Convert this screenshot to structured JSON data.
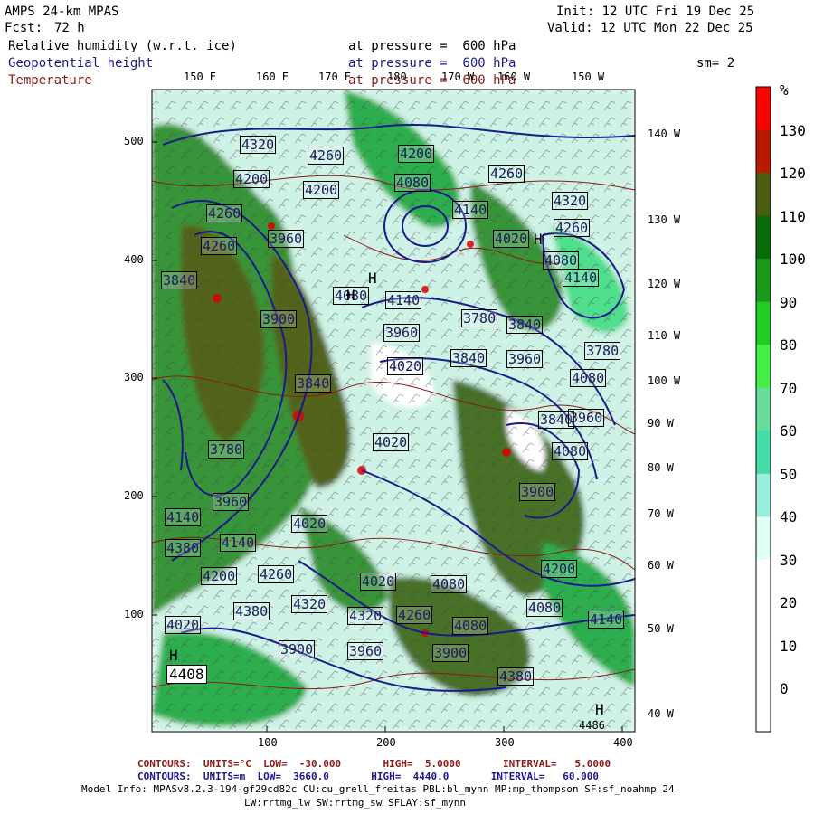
{
  "header": {
    "model": "AMPS 24-km MPAS",
    "fcst_label": "Fcst:",
    "fcst_value": "72 h",
    "init": "Init: 12 UTC Fri 19 Dec 25",
    "valid": "Valid: 12 UTC Mon 22 Dec 25",
    "fields": [
      {
        "name": "Relative humidity (w.r.t. ice)",
        "level": "at pressure =  600 hPa"
      },
      {
        "name": "Geopotential height",
        "level": "at pressure =  600 hPa"
      },
      {
        "name": "Temperature",
        "level": "at pressure =  600 hPa"
      }
    ],
    "smoothing": "sm= 2"
  },
  "axes": {
    "x_ticks": [
      "100",
      "200",
      "300",
      "400"
    ],
    "y_ticks": [
      "100",
      "200",
      "300",
      "400",
      "500"
    ],
    "top_lon": [
      "150 E",
      "160 E",
      "170 E",
      "180",
      "170 W",
      "160 W",
      "150 W"
    ],
    "right_lon": [
      "140 W",
      "130 W",
      "120 W",
      "110 W",
      "100 W",
      "90 W",
      "80 W",
      "70 W",
      "60 W",
      "50 W",
      "40 W"
    ]
  },
  "colorbar": {
    "unit": "%",
    "labels": [
      "130",
      "120",
      "110",
      "100",
      "90",
      "80",
      "70",
      "60",
      "50",
      "40",
      "30",
      "20",
      "10",
      "0"
    ],
    "colors": [
      "#ff0000",
      "#b81a00",
      "#4a5c10",
      "#0a6b0a",
      "#1a9a1a",
      "#22cc22",
      "#44ee44",
      "#66dd99",
      "#44ddaa",
      "#99eedd",
      "#ddfff4",
      "#ffffff",
      "#ffffff",
      "#ffffff",
      "#ffffff"
    ]
  },
  "height_labels": [
    "4320",
    "4260",
    "4200",
    "4260",
    "4260",
    "4080",
    "4140",
    "4320",
    "4200",
    "4200",
    "4260",
    "3960",
    "4260",
    "4020",
    "4080",
    "4140",
    "3840",
    "3900",
    "4080",
    "4140",
    "3780",
    "3840",
    "3780",
    "3960",
    "4020",
    "3840",
    "3960",
    "4080",
    "3840",
    "3840",
    "3780",
    "4020",
    "4080",
    "3960",
    "3960",
    "3900",
    "4140",
    "4020",
    "4140",
    "4380",
    "4260",
    "4200",
    "4020",
    "4080",
    "4200",
    "4080",
    "4380",
    "4320",
    "4320",
    "4260",
    "4080",
    "4020",
    "4140",
    "3900",
    "3960",
    "3900",
    "4380"
  ],
  "height_markers": [
    "H",
    "H",
    "H",
    "H",
    "H"
  ],
  "h4408": "4408",
  "h4486": "4486",
  "footer": {
    "line1": "CONTOURS:  UNITS=°C  LOW=  -30.000       HIGH=  5.0000       INTERVAL=   5.0000",
    "line2": "CONTOURS:  UNITS=m  LOW=  3660.0       HIGH=  4440.0       INTERVAL=   60.000",
    "line3": "Model Info: MPASv8.2.3-194-gf29cd82c CU:cu_grell_freitas PBL:bl_mynn MP:mp_thompson SF:sf_noahmp 24",
    "line4": "LW:rrtmg_lw SW:rrtmg_sw SFLAY:sf_mynn"
  }
}
